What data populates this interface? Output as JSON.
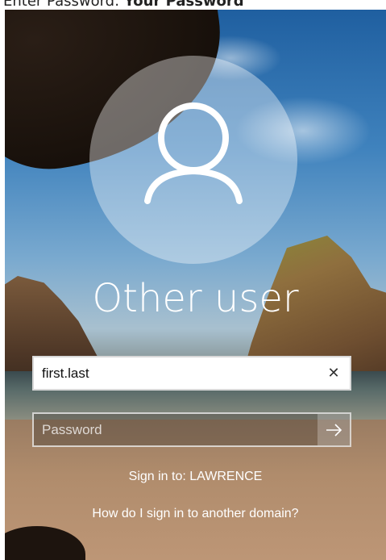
{
  "caption": {
    "prefix": "Enter Password:",
    "value": "Your Password"
  },
  "login": {
    "username_display": "Other user",
    "user_field": {
      "value": "first.last",
      "clear_icon": "close-icon",
      "clear_glyph": "✕"
    },
    "password_field": {
      "placeholder": "Password",
      "submit_icon": "arrow-right-icon"
    },
    "sign_in_to": "Sign in to: LAWRENCE",
    "other_domain_link": "How do I sign in to another domain?"
  },
  "colors": {
    "text": "#ffffff",
    "field_border": "#d8d8d8"
  }
}
